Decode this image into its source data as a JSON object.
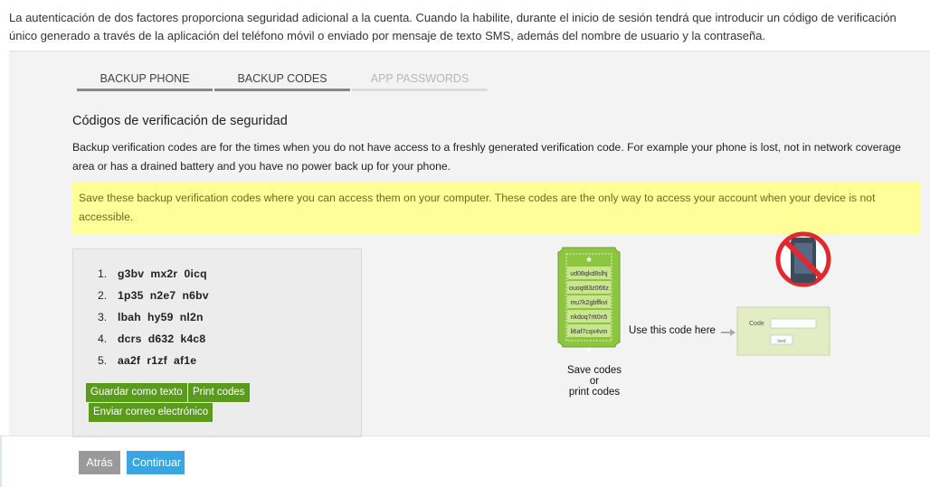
{
  "intro_text": "La autenticación de dos factores proporciona seguridad adicional a la cuenta. Cuando la habilite, durante el inicio de sesión tendrá que introducir un código de verificación único generado a través de la aplicación del teléfono móvil o enviado por mensaje de texto SMS, además del nombre de usuario y la contraseña.",
  "tabs": [
    {
      "label": "BACKUP PHONE",
      "state": "enabled"
    },
    {
      "label": "BACKUP CODES",
      "state": "active"
    },
    {
      "label": "APP PASSWORDS",
      "state": "disabled"
    }
  ],
  "section_title": "Códigos de verificación de seguridad",
  "description": "Backup verification codes are for the times when you do not have access to a freshly generated verification code. For example your phone is lost, not in network coverage area or has a drained battery and you have no power back up for your phone.",
  "warning": "Save these backup verification codes where you can access them on your computer. These codes are the only way to access your account when your device is not accessible.",
  "codes": [
    {
      "num": "1.",
      "code": "g3bv  mx2r  0icq"
    },
    {
      "num": "2.",
      "code": "1p35  n2e7  n6bv"
    },
    {
      "num": "3.",
      "code": "lbah  hy59  nl2n"
    },
    {
      "num": "4.",
      "code": "dcrs  d632  k4c8"
    },
    {
      "num": "5.",
      "code": "aa2f  r1zf  af1e"
    }
  ],
  "buttons": {
    "save_text": "Guardar como texto",
    "print_codes": "Print codes",
    "send_email": "Enviar correo electrónico",
    "back": "Atrás",
    "continue": "Continuar"
  },
  "illustration": {
    "ticket_codes": [
      "ud08qkd8slhj",
      "ouoqt83z066z",
      "mu7k2gbffkvi",
      "nkdoq7rtt0n5",
      "li6af7cqx4vm"
    ],
    "use_code_label": "Use this code here",
    "save_line1": "Save codes",
    "save_line2": "or",
    "save_line3": "print codes",
    "code_field_label": "Code",
    "code_button": "lsed"
  },
  "colors": {
    "green_button": "#5a9a1c",
    "continue_blue": "#3aa5e1",
    "back_gray": "#9a9a9a",
    "warning_bg": "#ffff99",
    "ticket_green": "#8cc63f",
    "no_sign_red": "#e0282e"
  }
}
